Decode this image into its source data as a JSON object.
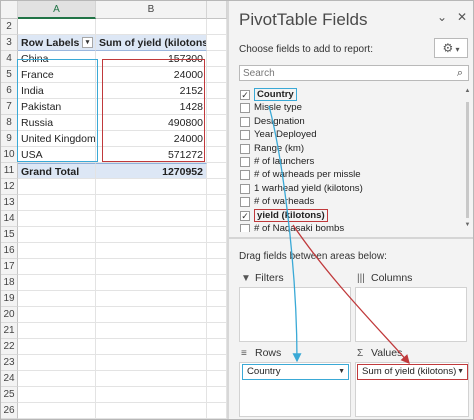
{
  "sheet": {
    "columns": [
      "A",
      "B"
    ],
    "row_numbers": [
      "2",
      "3",
      "4",
      "5",
      "6",
      "7",
      "8",
      "9",
      "10",
      "11",
      "12",
      "13",
      "14",
      "15",
      "16",
      "17",
      "18",
      "19",
      "20",
      "21",
      "22",
      "23",
      "24",
      "25",
      "26"
    ],
    "header": {
      "row_labels": "Row Labels",
      "sum_header": "Sum of yield (kilotons)",
      "filter_glyph": "▾"
    },
    "rows": [
      {
        "label": "China",
        "value": "157300"
      },
      {
        "label": "France",
        "value": "24000"
      },
      {
        "label": "India",
        "value": "2152"
      },
      {
        "label": "Pakistan",
        "value": "1428"
      },
      {
        "label": "Russia",
        "value": "490800"
      },
      {
        "label": "United Kingdom",
        "value": "24000"
      },
      {
        "label": "USA",
        "value": "571272"
      }
    ],
    "grand_total": {
      "label": "Grand Total",
      "value": "1270952"
    }
  },
  "pane": {
    "title": "PivotTable Fields",
    "icons": {
      "dropdown": "chevron-down-icon",
      "close": "close-icon",
      "gear": "gear-icon",
      "search": "search-icon"
    },
    "choose_label": "Choose fields to add to report:",
    "search_placeholder": "Search",
    "fields": [
      {
        "label": "Country",
        "checked": true,
        "highlight": "#3aa9d6"
      },
      {
        "label": "Missle type",
        "checked": false
      },
      {
        "label": "Designation",
        "checked": false
      },
      {
        "label": "Year Deployed",
        "checked": false
      },
      {
        "label": "Range (km)",
        "checked": false
      },
      {
        "label": "# of launchers",
        "checked": false
      },
      {
        "label": "# of warheads per missle",
        "checked": false
      },
      {
        "label": "1 warhead yield  (kilotons)",
        "checked": false
      },
      {
        "label": "# of warheads",
        "checked": false
      },
      {
        "label": "yield (kilotons)",
        "checked": true,
        "highlight": "#c0393b"
      },
      {
        "label": "# of Nagasaki bombs",
        "checked": false
      }
    ],
    "drag_label": "Drag fields between areas below:",
    "areas": {
      "filters": {
        "label": "Filters",
        "icon": "filter-icon"
      },
      "columns": {
        "label": "Columns",
        "icon": "columns-icon"
      },
      "rows": {
        "label": "Rows",
        "icon": "rows-icon",
        "chip": "Country"
      },
      "values": {
        "label": "Values",
        "icon": "sigma-icon",
        "chip": "Sum of yield (kilotons)"
      }
    }
  },
  "colors": {
    "rows_highlight": "#3aa9d6",
    "values_highlight": "#c0393b",
    "pivot_header_fill": "#dde7f5",
    "excel_green": "#217346"
  }
}
